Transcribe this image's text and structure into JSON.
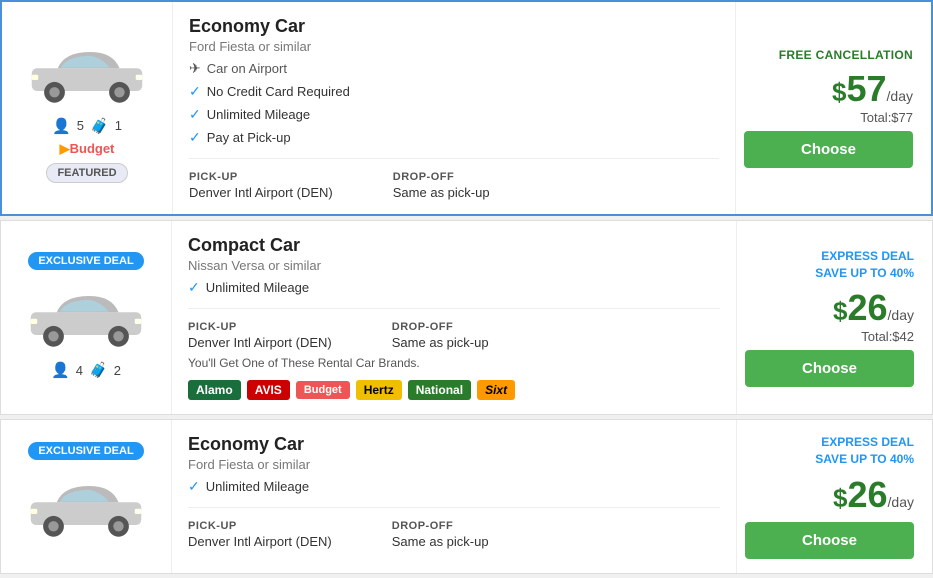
{
  "cards": [
    {
      "id": "card-1",
      "badge": "FEATURED",
      "badge_type": "featured",
      "car_title": "Economy Car",
      "car_subtitle": "Ford Fiesta or similar",
      "airport": "Car on Airport",
      "features": [
        "No Credit Card Required",
        "Unlimited Mileage",
        "Pay at Pick-up"
      ],
      "pickup_label": "PICK-UP",
      "pickup_value": "Denver Intl Airport (DEN)",
      "dropoff_label": "DROP-OFF",
      "dropoff_value": "Same as pick-up",
      "passengers": "5",
      "bags": "1",
      "brand_logo": "Budget",
      "promo_label": "FREE CANCELLATION",
      "promo_type": "free_cancel",
      "price_day": "57",
      "price_total": "Total:$77",
      "choose_label": "Choose",
      "brands": [],
      "brands_text": ""
    },
    {
      "id": "card-2",
      "badge": "EXCLUSIVE DEAL",
      "badge_type": "exclusive",
      "car_title": "Compact Car",
      "car_subtitle": "Nissan Versa or similar",
      "airport": "",
      "features": [
        "Unlimited Mileage"
      ],
      "pickup_label": "PICK-UP",
      "pickup_value": "Denver Intl Airport (DEN)",
      "dropoff_label": "DROP-OFF",
      "dropoff_value": "Same as pick-up",
      "passengers": "4",
      "bags": "2",
      "brand_logo": "",
      "promo_label": "EXPRESS DEAL\nSAVE UP TO 40%",
      "promo_type": "express_deal",
      "price_day": "26",
      "price_total": "Total:$42",
      "choose_label": "Choose",
      "brands_text": "You'll Get One of These Rental Car Brands.",
      "brands": [
        "Alamo",
        "AVIS",
        "Budget",
        "Hertz",
        "National",
        "Sixt"
      ]
    },
    {
      "id": "card-3",
      "badge": "EXCLUSIVE DEAL",
      "badge_type": "exclusive",
      "car_title": "Economy Car",
      "car_subtitle": "Ford Fiesta or similar",
      "airport": "",
      "features": [
        "Unlimited Mileage"
      ],
      "pickup_label": "PICK-UP",
      "pickup_value": "Denver Intl Airport (DEN)",
      "dropoff_label": "DROP-OFF",
      "dropoff_value": "Same as pick-up",
      "passengers": "",
      "bags": "",
      "brand_logo": "",
      "promo_label": "EXPRESS DEAL\nSAVE UP TO 40%",
      "promo_type": "express_deal",
      "price_day": "26",
      "price_total": "",
      "choose_label": "Choose",
      "brands_text": "",
      "brands": []
    }
  ]
}
